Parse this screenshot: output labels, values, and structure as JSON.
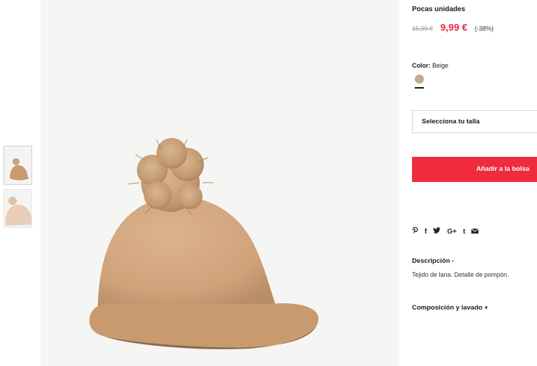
{
  "product": {
    "stock_label": "Pocas unidades",
    "old_price": "15,99 €",
    "new_price": "9,99 €",
    "discount": "(-38%)",
    "color_label": "Color:",
    "color_value": "Beige",
    "swatch_color": "#c2ac94",
    "size_select_label": "Selecciona tu talla",
    "add_to_bag_label": "Añadir a la bolsa"
  },
  "share": {
    "icons": [
      "pinterest-icon",
      "facebook-icon",
      "twitter-icon",
      "google-plus-icon",
      "tumblr-icon",
      "email-icon"
    ],
    "pinterest": "℗",
    "facebook": "f",
    "twitter": "♥",
    "google_plus": "G+",
    "tumblr": "t",
    "email": "✉"
  },
  "description": {
    "title": "Descripción -",
    "text": "Tejido de lana. Detalle de pompón."
  },
  "composition": {
    "title": "Composición y lavado +"
  },
  "colors": {
    "accent": "#f02b3d",
    "price_red": "#e8253b",
    "hat": "#d4a77e",
    "pompom": "#c9a27a"
  }
}
